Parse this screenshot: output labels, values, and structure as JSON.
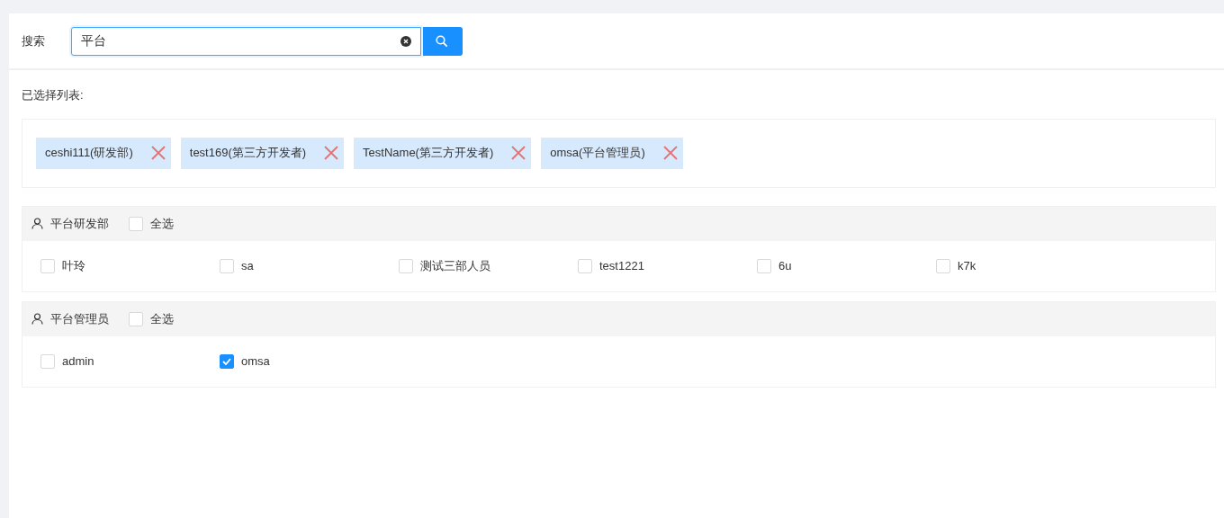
{
  "search": {
    "label": "搜索",
    "value": "平台"
  },
  "selected_title": "已选择列表:",
  "selected": [
    {
      "label": "ceshi111(研发部)"
    },
    {
      "label": "test169(第三方开发者)"
    },
    {
      "label": "TestName(第三方开发者)"
    },
    {
      "label": "omsa(平台管理员)"
    }
  ],
  "groups": [
    {
      "name": "平台研发部",
      "select_all": {
        "label": "全选",
        "checked": false
      },
      "members": [
        {
          "name": "叶玲",
          "checked": false
        },
        {
          "name": "sa",
          "checked": false
        },
        {
          "name": "测试三部人员",
          "checked": false
        },
        {
          "name": "test1221",
          "checked": false
        },
        {
          "name": "6u",
          "checked": false
        },
        {
          "name": "k7k",
          "checked": false
        }
      ]
    },
    {
      "name": "平台管理员",
      "select_all": {
        "label": "全选",
        "checked": false
      },
      "members": [
        {
          "name": "admin",
          "checked": false
        },
        {
          "name": "omsa",
          "checked": true
        }
      ]
    }
  ]
}
